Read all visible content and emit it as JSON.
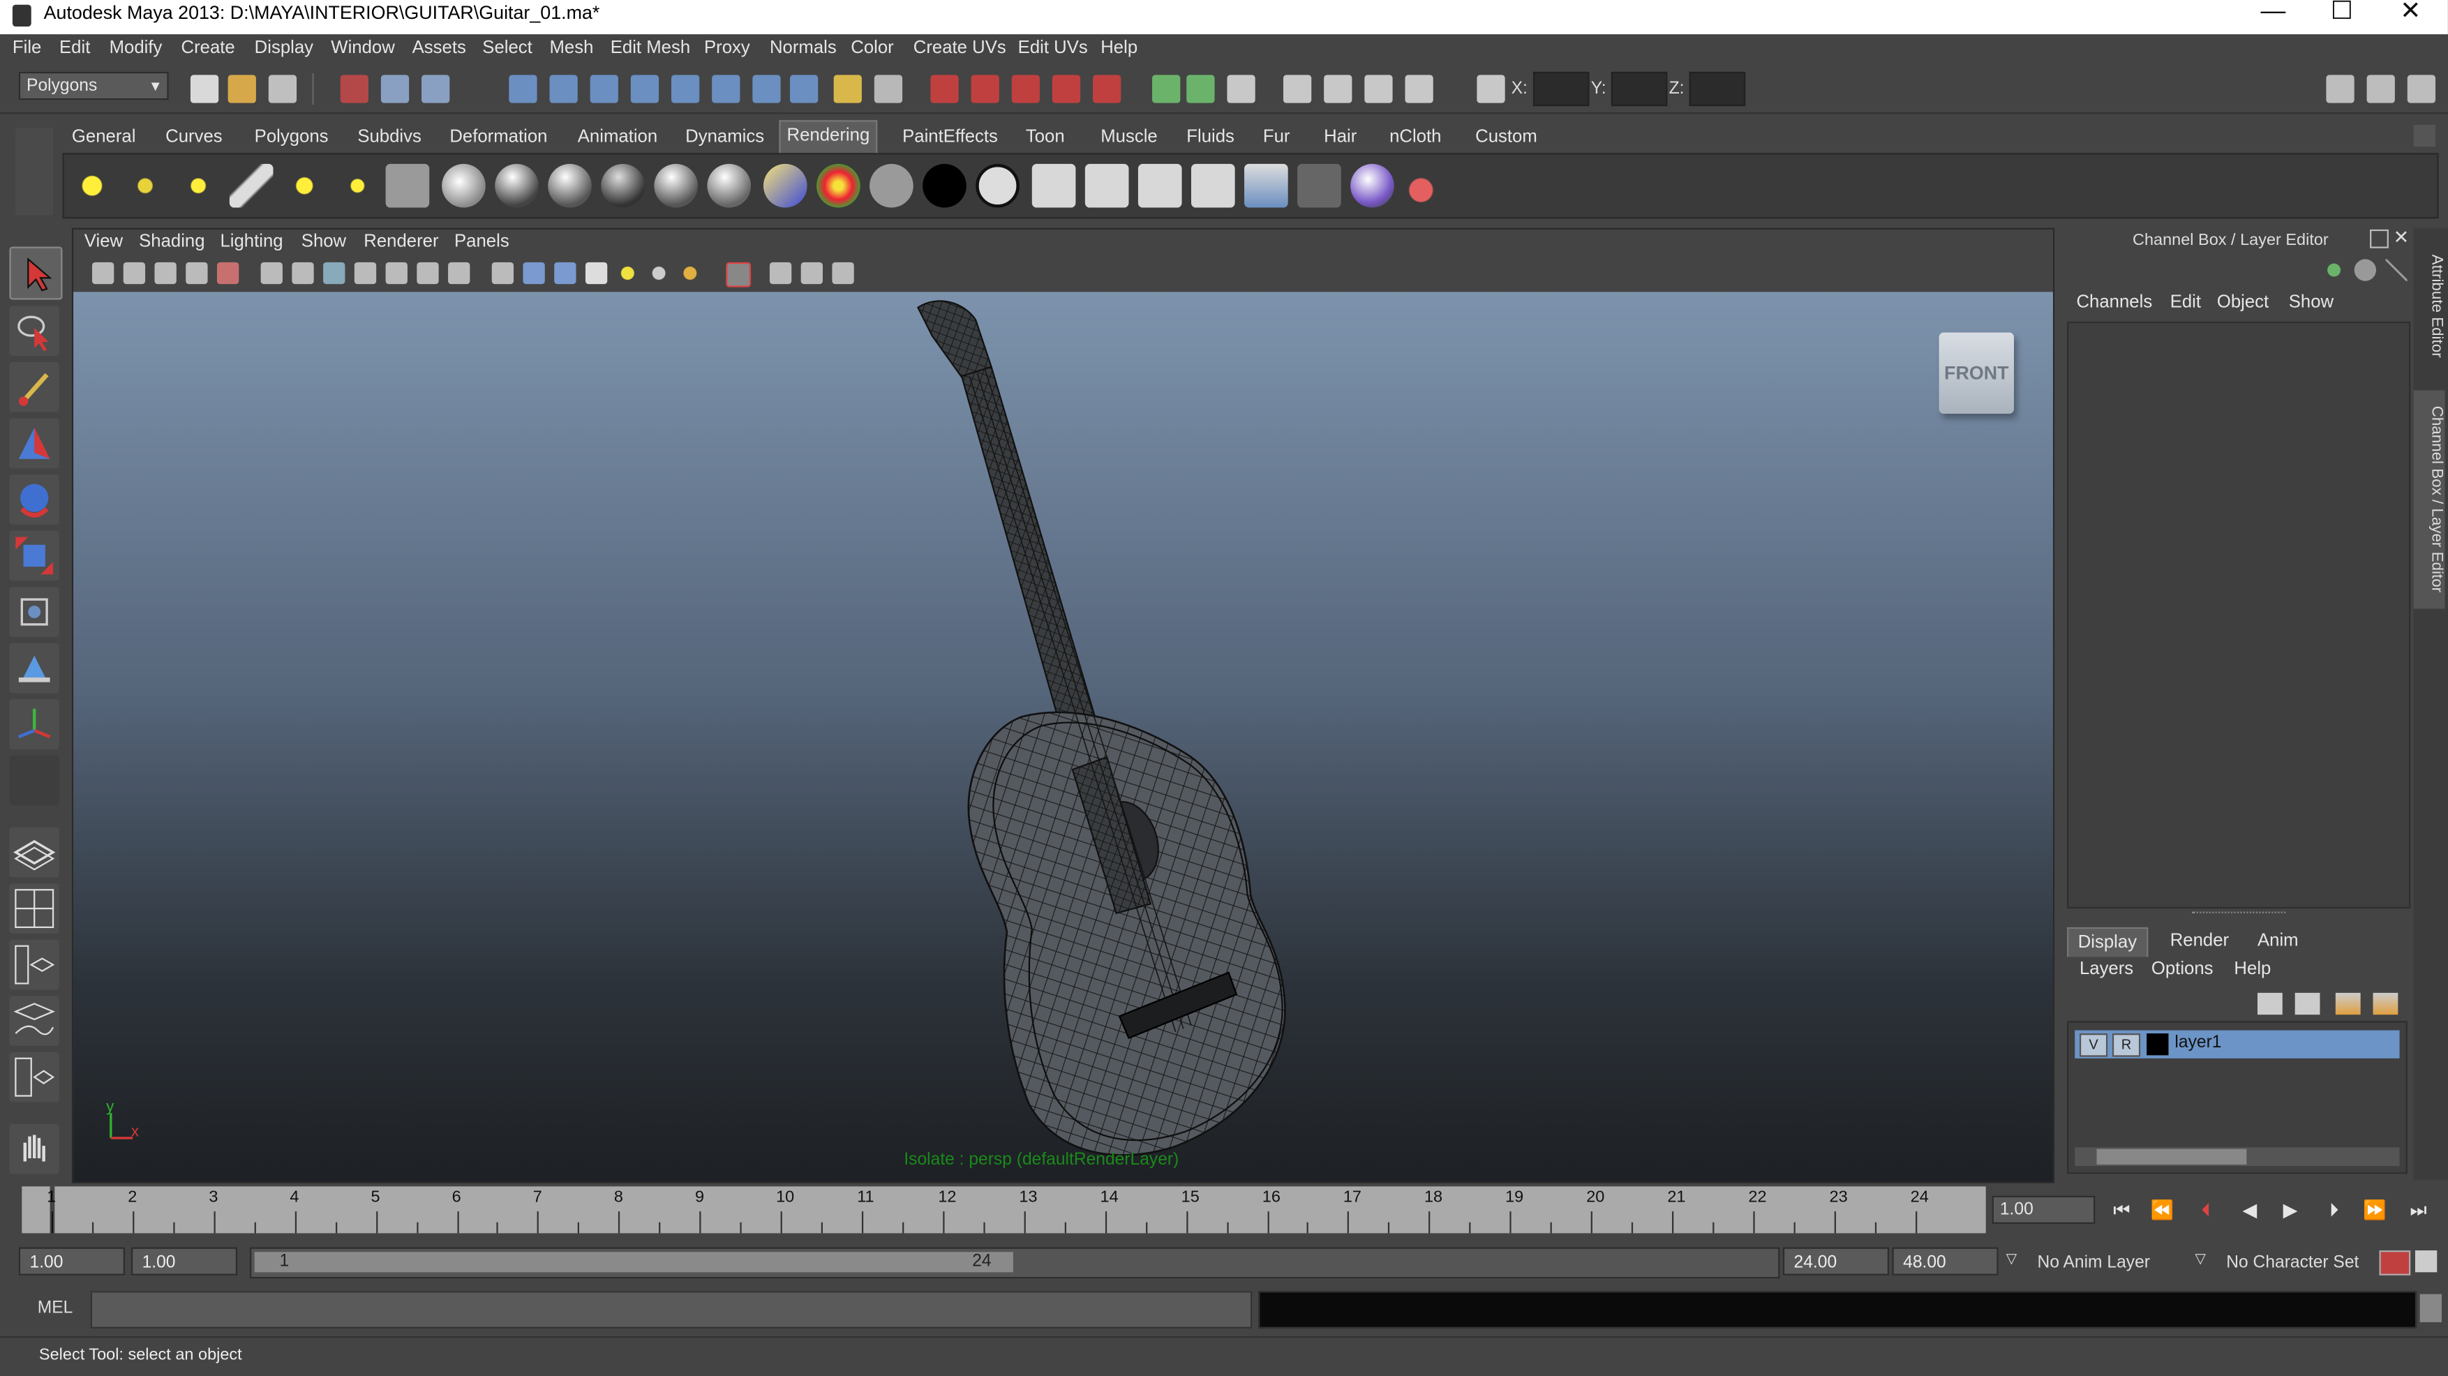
{
  "window": {
    "title": "Autodesk Maya 2013: D:\\MAYA\\INTERIOR\\GUITAR\\Guitar_01.ma*",
    "minimize": "—",
    "maximize": "☐",
    "close": "✕"
  },
  "menubar": [
    "File",
    "Edit",
    "Modify",
    "Create",
    "Display",
    "Window",
    "Assets",
    "Select",
    "Mesh",
    "Edit Mesh",
    "Proxy",
    "Normals",
    "Color",
    "Create UVs",
    "Edit UVs",
    "Help"
  ],
  "statusline": {
    "mode": "Polygons",
    "x_label": "X:",
    "y_label": "Y:",
    "z_label": "Z:"
  },
  "shelf": {
    "tabs": [
      "General",
      "Curves",
      "Polygons",
      "Subdivs",
      "Deformation",
      "Animation",
      "Dynamics",
      "Rendering",
      "PaintEffects",
      "Toon",
      "Muscle",
      "Fluids",
      "Fur",
      "Hair",
      "nCloth",
      "Custom"
    ],
    "active_tab": "Rendering"
  },
  "viewport": {
    "menu": [
      "View",
      "Shading",
      "Lighting",
      "Show",
      "Renderer",
      "Panels"
    ],
    "cube_label": "FRONT",
    "isolate_text": "Isolate : persp (defaultRenderLayer)",
    "axis_y": "y",
    "axis_x": "x"
  },
  "channelbox": {
    "title": "Channel Box / Layer Editor",
    "menu": [
      "Channels",
      "Edit",
      "Object",
      "Show"
    ]
  },
  "layer_editor": {
    "tabs": [
      "Display",
      "Render",
      "Anim"
    ],
    "active_tab": "Display",
    "menu": [
      "Layers",
      "Options",
      "Help"
    ],
    "layer_v": "V",
    "layer_r": "R",
    "layer_name": "layer1"
  },
  "side_tabs": [
    "Attribute Editor",
    "Channel Box / Layer Editor"
  ],
  "timeslider": {
    "frames": [
      "1",
      "2",
      "3",
      "4",
      "5",
      "6",
      "7",
      "8",
      "9",
      "10",
      "11",
      "12",
      "13",
      "14",
      "15",
      "16",
      "17",
      "18",
      "19",
      "20",
      "21",
      "22",
      "23",
      "24"
    ],
    "current_frame": "1.00"
  },
  "range": {
    "start": "1.00",
    "playback_start": "1.00",
    "slider_start": "1",
    "slider_end": "24",
    "playback_end": "24.00",
    "end": "48.00",
    "anim_layer": "No Anim Layer",
    "character_set": "No Character Set"
  },
  "command": {
    "mel_label": "MEL"
  },
  "helpline": {
    "text": "Select Tool: select an object"
  },
  "colors": {
    "ui_bg": "#444444",
    "layer_highlight": "#6c94c6",
    "isolate_text": "#1a8a1a"
  }
}
